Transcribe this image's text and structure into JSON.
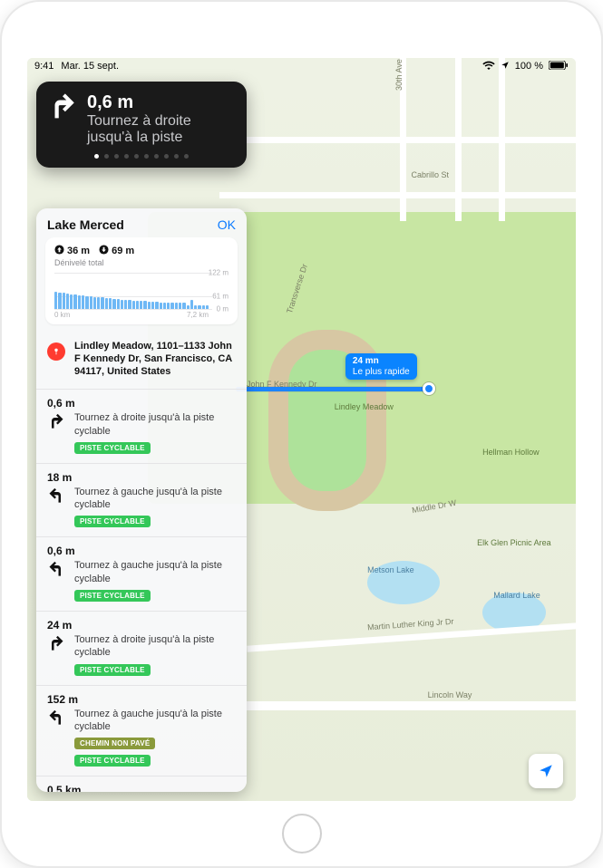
{
  "statusbar": {
    "time": "9:41",
    "date": "Mar. 15 sept.",
    "battery": "100 %"
  },
  "nav": {
    "distance": "0,6 m",
    "instruction": "Tournez à droite jusqu'à la piste"
  },
  "panel": {
    "title": "Lake Merced",
    "ok": "OK",
    "elev": {
      "up": "36 m",
      "down": "69 m",
      "subtitle": "Dénivelé total",
      "y_top": "122 m",
      "y_mid": "61 m",
      "y_bot": "0 m",
      "x_start": "0 km",
      "x_end": "7,2 km"
    },
    "address": "Lindley Meadow, 1101–1133 John F Kennedy Dr, San Francisco, CA 94117, United States",
    "steps": [
      {
        "dist": "0,6 m",
        "dir": "right",
        "instr": "Tournez à droite jusqu'à la piste cyclable",
        "tags": [
          {
            "text": "PISTE CYCLABLE",
            "cls": "green"
          }
        ]
      },
      {
        "dist": "18 m",
        "dir": "left",
        "instr": "Tournez à gauche jusqu'à la piste cyclable",
        "tags": [
          {
            "text": "PISTE CYCLABLE",
            "cls": "green"
          }
        ]
      },
      {
        "dist": "0,6 m",
        "dir": "left",
        "instr": "Tournez à gauche jusqu'à la piste cyclable",
        "tags": [
          {
            "text": "PISTE CYCLABLE",
            "cls": "green"
          }
        ]
      },
      {
        "dist": "24 m",
        "dir": "right",
        "instr": "Tournez à droite jusqu'à la piste cyclable",
        "tags": [
          {
            "text": "PISTE CYCLABLE",
            "cls": "green"
          }
        ]
      },
      {
        "dist": "152 m",
        "dir": "left",
        "instr": "Tournez à gauche jusqu'à la piste cyclable",
        "tags": [
          {
            "text": "CHEMIN NON PAVÉ",
            "cls": "olive"
          },
          {
            "text": "PISTE CYCLABLE",
            "cls": "green"
          }
        ]
      },
      {
        "dist": "0,5 km",
        "dir": "straight",
        "instr": "",
        "tags": []
      }
    ]
  },
  "route_badge": {
    "line1": "24 mn",
    "line2": "Le plus rapide"
  },
  "map_labels": {
    "jfkdr": "John F Kennedy Dr",
    "lindley": "Lindley Meadow",
    "hellman": "Hellman Hollow",
    "middle": "Middle Dr W",
    "metson": "Metson Lake",
    "elkglen": "Elk Glen Picnic Area",
    "mallard": "Mallard Lake",
    "mlk": "Martin Luther King Jr Dr",
    "lincoln": "Lincoln Way",
    "cabrillo": "Cabrillo St",
    "ave30": "30th Ave",
    "transverse": "Transverse Dr"
  },
  "chart_data": {
    "type": "bar",
    "title": "Dénivelé total",
    "xlabel": "km",
    "ylabel": "m",
    "x_range": [
      0,
      7.2
    ],
    "ylim": [
      0,
      122
    ],
    "values": [
      58,
      56,
      54,
      52,
      50,
      49,
      47,
      46,
      44,
      42,
      41,
      40,
      39,
      38,
      36,
      34,
      33,
      32,
      31,
      30,
      29,
      28,
      27,
      26,
      25,
      24,
      23,
      22,
      22,
      21,
      21,
      20,
      20,
      20,
      12,
      32,
      12,
      12,
      12,
      12
    ]
  }
}
